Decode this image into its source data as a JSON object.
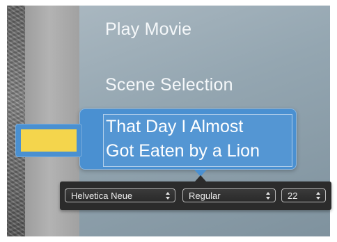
{
  "menu": {
    "items": [
      "Play Movie",
      "Scene Selection"
    ],
    "selected_title_lines": [
      "That Day I Almost",
      "Got Eaten by a Lion"
    ]
  },
  "font_toolbar": {
    "font_family": "Helvetica Neue",
    "font_style": "Regular",
    "font_size": "22"
  },
  "colors": {
    "selection_blue": "#4a90d1",
    "highlight_yellow": "#f4d54c",
    "toolbar_dark": "#2b2b2b",
    "menu_text": "#f5f8fa"
  },
  "icons": {
    "stepper": "up-down-arrows-icon"
  }
}
